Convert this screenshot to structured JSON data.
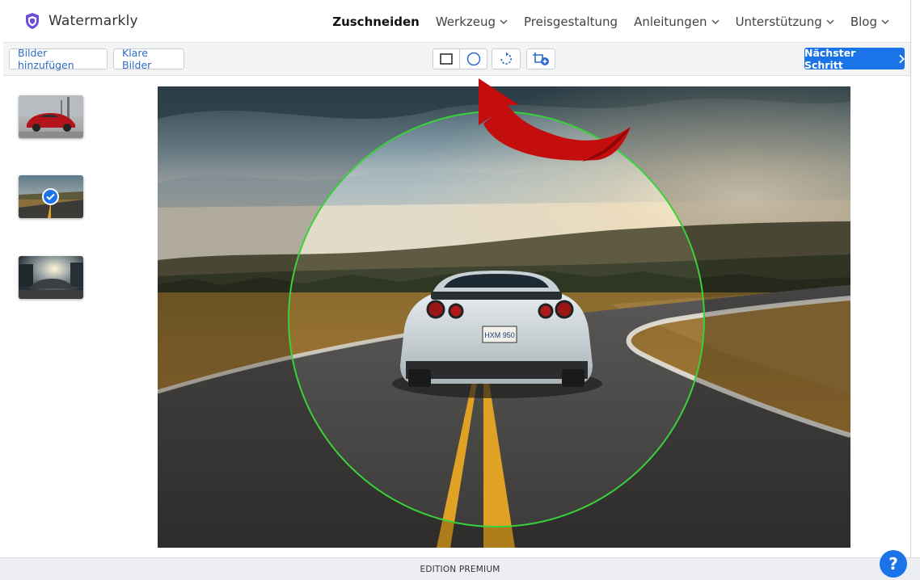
{
  "brand": {
    "name": "Watermarkly",
    "logo_icon": "shield-icon",
    "color": "#6b4fd8"
  },
  "nav": {
    "items": [
      {
        "label": "Zuschneiden",
        "active": true,
        "dropdown": false
      },
      {
        "label": "Werkzeug",
        "active": false,
        "dropdown": true
      },
      {
        "label": "Preisgestaltung",
        "active": false,
        "dropdown": false
      },
      {
        "label": "Anleitungen",
        "active": false,
        "dropdown": true
      },
      {
        "label": "Unterstützung",
        "active": false,
        "dropdown": true
      },
      {
        "label": "Blog",
        "active": false,
        "dropdown": true
      }
    ]
  },
  "toolbar": {
    "add_images_label": "Bilder hinzufügen",
    "clear_images_label": "Klare Bilder",
    "shape_tools": [
      "rectangle-crop-icon",
      "circle-crop-icon"
    ],
    "rotate_icon": "rotate-icon",
    "add_crop_icon": "crop-add-icon",
    "next_label": "Nächster Schritt",
    "accent": "#1a73e8"
  },
  "thumbnails": [
    {
      "name": "red-porsche-thumbnail",
      "selected": false
    },
    {
      "name": "road-car-thumbnail",
      "selected": true
    },
    {
      "name": "dark-car-thumbnail",
      "selected": false
    }
  ],
  "editor": {
    "crop_shape": "circle",
    "crop_outline_color": "#39d23a",
    "plate_text": "HXM 950"
  },
  "annotation": {
    "arrow_color": "#c40d0d"
  },
  "footer": {
    "label": "EDITION PREMIUM"
  },
  "help": {
    "label": "?"
  }
}
